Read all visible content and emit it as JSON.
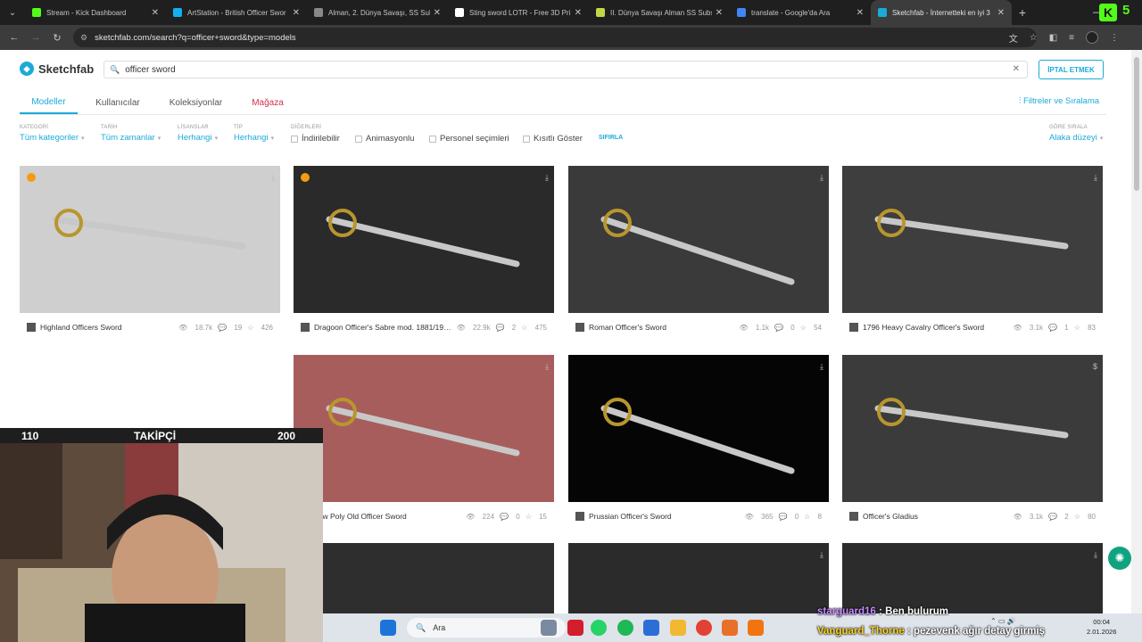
{
  "browser": {
    "tabs": [
      {
        "title": "Stream - Kick Dashboard",
        "color": "#53fc18"
      },
      {
        "title": "ArtStation - British Officer Swor",
        "color": "#13aff0"
      },
      {
        "title": "Alman, 2. Dünya Savaşı, SS Sub",
        "color": "#888888"
      },
      {
        "title": "Sting sword LOTR - Free 3D Pri",
        "color": "#ffffff"
      },
      {
        "title": "II. Dünya Savaşı Alman SS Subs",
        "color": "#c3d645"
      },
      {
        "title": "translate - Google'da Ara",
        "color": "#4285f4"
      },
      {
        "title": "Sketchfab - İnternetteki en iyi 3",
        "color": "#1caad9"
      }
    ],
    "url": "sketchfab.com/search?q=officer+sword&type=models"
  },
  "header": {
    "logo_text": "Sketchfab",
    "search_value": "officer sword",
    "cancel_label": "İPTAL ETMEK"
  },
  "nav": {
    "tabs": [
      "Modeller",
      "Kullanıcılar",
      "Koleksiyonlar",
      "Mağaza"
    ],
    "filters_link": "Filtreler ve Sıralama"
  },
  "filters": {
    "category": {
      "label": "KATEGORİ",
      "value": "Tüm kategoriler"
    },
    "date": {
      "label": "TARİH",
      "value": "Tüm zamanlar"
    },
    "license": {
      "label": "LİSANSLAR",
      "value": "Herhangi"
    },
    "type": {
      "label": "TİP",
      "value": "Herhangi"
    },
    "others_label": "DİĞERLERİ",
    "checks": [
      "İndirilebilir",
      "Animasyonlu",
      "Personel seçimleri",
      "Kısıtlı Göster"
    ],
    "reset": "SIFIRLA",
    "sort": {
      "label": "GÖRE SIRALA",
      "value": "Alaka düzeyi"
    }
  },
  "models": [
    {
      "title": "Highland Officers Sword",
      "views": "18.7k",
      "comments": "19",
      "likes": "426",
      "bg": "#cfcfcf"
    },
    {
      "title": "Dragoon Officer's Sabre mod. 1881/1909 ...",
      "views": "22.9k",
      "comments": "2",
      "likes": "475",
      "bg": "#2a2a2a"
    },
    {
      "title": "Roman Officer's Sword",
      "views": "1.1k",
      "comments": "0",
      "likes": "54",
      "bg": "#3a3a3a"
    },
    {
      "title": "1796 Heavy Cavalry Officer's Sword",
      "views": "3.1k",
      "comments": "1",
      "likes": "83",
      "bg": "#3e3e3e"
    },
    {
      "title": "Low Poly Old Officer Sword",
      "views": "224",
      "comments": "0",
      "likes": "15",
      "bg": "#a85d5d"
    },
    {
      "title": "Prussian Officer's Sword",
      "views": "365",
      "comments": "0",
      "likes": "8",
      "bg": "#050505"
    },
    {
      "title": "Officer's Gladius",
      "views": "3.1k",
      "comments": "2",
      "likes": "80",
      "bg": "#3b3b3b"
    }
  ],
  "overlay": {
    "count_left": "110",
    "count_label": "TAKİPÇİ",
    "count_right": "200",
    "kick_number": "5",
    "chat": [
      {
        "user": "starguard16",
        "text": "Ben bulurum"
      },
      {
        "user": "Vanguard_Thorne",
        "text": "pezevenk ağır detay girmiş"
      }
    ]
  },
  "taskbar": {
    "search_placeholder": "Ara",
    "time": "00:04",
    "date": "2.01.2026"
  }
}
